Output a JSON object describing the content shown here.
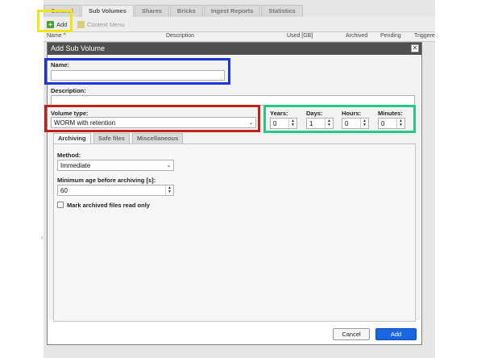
{
  "tabs": [
    {
      "label": "General"
    },
    {
      "label": "Sub Volumes"
    },
    {
      "label": "Shares"
    },
    {
      "label": "Bricks"
    },
    {
      "label": "Ingest Reports"
    },
    {
      "label": "Statistics"
    }
  ],
  "toolbar": {
    "add_label": "Add",
    "context_menu_label": "Context Menu"
  },
  "columns": [
    "Name ^",
    "Description",
    "Used [GB]",
    "Archived",
    "Pending",
    "Triggere"
  ],
  "dialog": {
    "title": "Add Sub Volume",
    "close_glyph": "✕",
    "name_label": "Name:",
    "name_value": "",
    "description_label": "Description:",
    "description_value": "",
    "volume_type_label": "Volume type:",
    "volume_type_value": "WORM with retention",
    "retention": {
      "years_label": "Years:",
      "years_value": "0",
      "days_label": "Days:",
      "days_value": "1",
      "hours_label": "Hours:",
      "hours_value": "0",
      "minutes_label": "Minutes:",
      "minutes_value": "0"
    },
    "inner_tabs": [
      {
        "label": "Archiving"
      },
      {
        "label": "Safe files"
      },
      {
        "label": "Miscellaneous"
      }
    ],
    "archiving": {
      "method_label": "Method:",
      "method_value": "Immediate",
      "min_age_label": "Minimum age before archiving [s]:",
      "min_age_value": "60",
      "readonly_label": "Mark archived files read only",
      "readonly_checked": false
    },
    "cancel_label": "Cancel",
    "add_label": "Add"
  },
  "colors": {
    "highlight_yellow": "#f5e21b",
    "highlight_blue": "#1f34d6",
    "highlight_red": "#c0211c",
    "highlight_green": "#28c88b",
    "primary_button": "#1a66e0"
  },
  "icons": {
    "add": "plus-icon",
    "context_menu": "context-menu-icon",
    "close": "close-icon"
  }
}
